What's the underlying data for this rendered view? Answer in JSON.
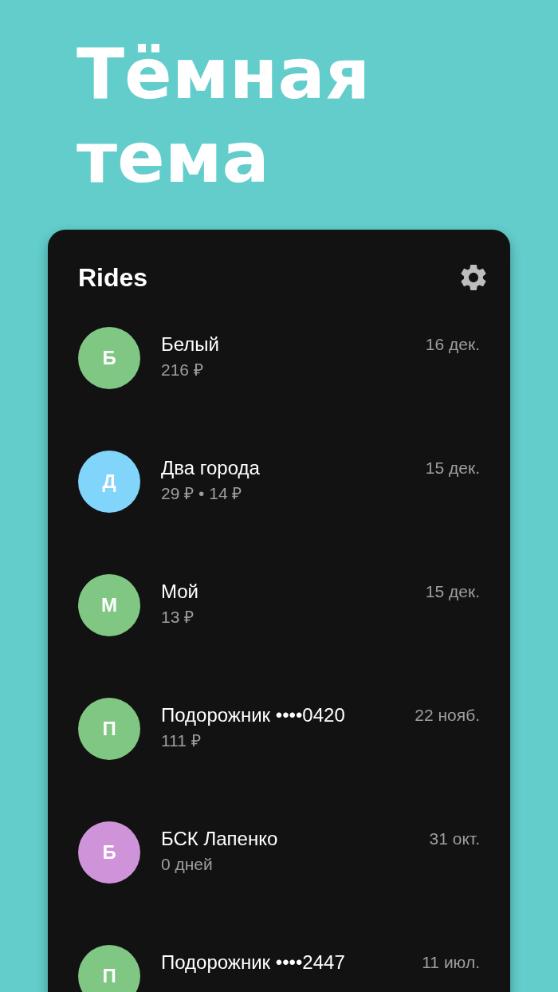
{
  "headline": [
    "Тёмная",
    "тема"
  ],
  "app": {
    "title": "Rides"
  },
  "rides": [
    {
      "initial": "Б",
      "color": "#81c784",
      "name": "Белый",
      "detail": "216 ₽",
      "date": "16 дек."
    },
    {
      "initial": "Д",
      "color": "#81d4fa",
      "name": "Два города",
      "detail": "29 ₽ • 14 ₽",
      "date": "15 дек."
    },
    {
      "initial": "М",
      "color": "#81c784",
      "name": "Мой",
      "detail": "13 ₽",
      "date": "15 дек."
    },
    {
      "initial": "П",
      "color": "#81c784",
      "name": "Подорожник ••••0420",
      "detail": "111 ₽",
      "date": "22 нояб."
    },
    {
      "initial": "Б",
      "color": "#ce93d8",
      "name": "БСК Лапенко",
      "detail": "0 дней",
      "date": "31 окт."
    },
    {
      "initial": "П",
      "color": "#81c784",
      "name": "Подорожник ••••2447",
      "date": "11 июл."
    }
  ]
}
